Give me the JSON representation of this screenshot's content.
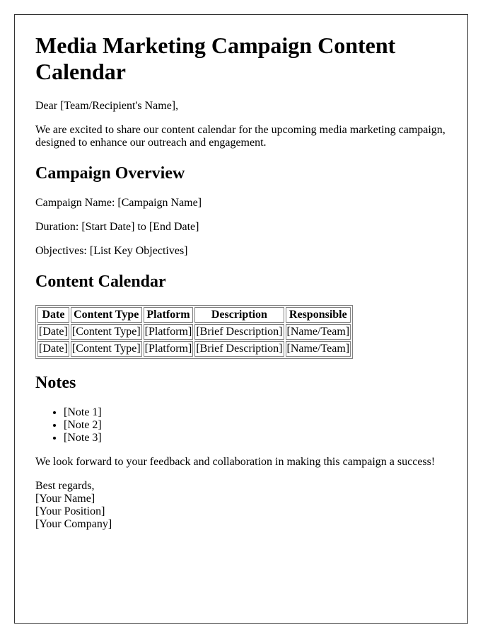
{
  "document": {
    "title": "Media Marketing Campaign Content Calendar",
    "salutation": "Dear [Team/Recipient's Name],",
    "intro": "We are excited to share our content calendar for the upcoming media marketing campaign, designed to enhance our outreach and engagement."
  },
  "overview": {
    "heading": "Campaign Overview",
    "campaign_name": "Campaign Name: [Campaign Name]",
    "duration": "Duration: [Start Date] to [End Date]",
    "objectives": "Objectives: [List Key Objectives]"
  },
  "calendar": {
    "heading": "Content Calendar",
    "columns": [
      "Date",
      "Content Type",
      "Platform",
      "Description",
      "Responsible"
    ],
    "rows": [
      [
        "[Date]",
        "[Content Type]",
        "[Platform]",
        "[Brief Description]",
        "[Name/Team]"
      ],
      [
        "[Date]",
        "[Content Type]",
        "[Platform]",
        "[Brief Description]",
        "[Name/Team]"
      ]
    ]
  },
  "notes": {
    "heading": "Notes",
    "items": [
      "[Note 1]",
      "[Note 2]",
      "[Note 3]"
    ]
  },
  "closing": {
    "message": "We look forward to your feedback and collaboration in making this campaign a success!",
    "signoff": "Best regards,",
    "name": "[Your Name]",
    "position": "[Your Position]",
    "company": "[Your Company]"
  }
}
